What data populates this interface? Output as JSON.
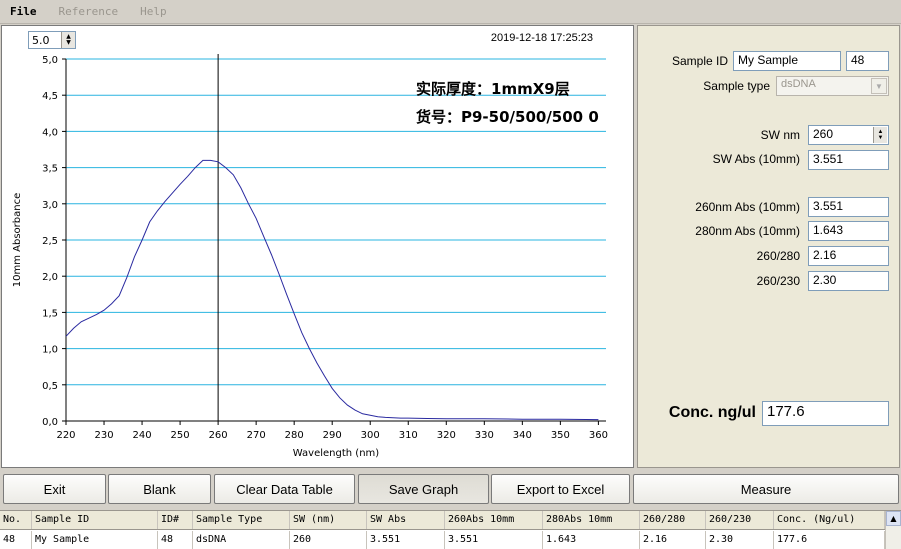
{
  "menu": [
    {
      "label": "File",
      "enabled": true
    },
    {
      "label": "Reference",
      "enabled": false
    },
    {
      "label": "Help",
      "enabled": false
    }
  ],
  "chart": {
    "scale_value": "5.0",
    "timestamp": "2019-12-18 17:25:23",
    "annotation_1": "实际厚度：1mmX9层",
    "annotation_2": "货号：P9-50/500/500 0",
    "line_color": "#2a2aa0",
    "grid_color": "#2ab4e0",
    "cursor_x": 260
  },
  "chart_data": {
    "type": "line",
    "xlabel": "Wavelength (nm)",
    "ylabel": "10mm Absorbance",
    "xlim": [
      220,
      362
    ],
    "ylim": [
      0,
      5
    ],
    "x_ticks": [
      "220",
      "230",
      "240",
      "250",
      "260",
      "270",
      "280",
      "290",
      "300",
      "310",
      "320",
      "330",
      "340",
      "350",
      "360"
    ],
    "y_ticks": [
      "0,0",
      "0,5",
      "1,0",
      "1,5",
      "2,0",
      "2,5",
      "3,0",
      "3,5",
      "4,0",
      "4,5",
      "5,0"
    ],
    "grid": true,
    "x": [
      220,
      222,
      224,
      226,
      228,
      230,
      232,
      234,
      236,
      238,
      240,
      242,
      244,
      246,
      248,
      250,
      252,
      254,
      256,
      258,
      260,
      262,
      264,
      266,
      268,
      270,
      272,
      274,
      276,
      278,
      280,
      282,
      284,
      286,
      288,
      290,
      292,
      294,
      296,
      298,
      300,
      302,
      304,
      306,
      308,
      310,
      315,
      320,
      330,
      340,
      350,
      360
    ],
    "y": [
      1.17,
      1.28,
      1.37,
      1.42,
      1.47,
      1.53,
      1.62,
      1.73,
      1.98,
      2.27,
      2.5,
      2.75,
      2.9,
      3.03,
      3.15,
      3.27,
      3.38,
      3.5,
      3.6,
      3.6,
      3.58,
      3.5,
      3.4,
      3.22,
      3.0,
      2.8,
      2.55,
      2.3,
      2.03,
      1.75,
      1.48,
      1.22,
      1.0,
      0.8,
      0.62,
      0.45,
      0.32,
      0.22,
      0.15,
      0.1,
      0.08,
      0.06,
      0.05,
      0.045,
      0.04,
      0.04,
      0.035,
      0.03,
      0.03,
      0.025,
      0.025,
      0.02
    ]
  },
  "right_panel": {
    "sample_id_label": "Sample ID",
    "sample_id_value": "My Sample",
    "sample_num_value": "48",
    "sample_type_label": "Sample type",
    "sample_type_value": "dsDNA",
    "sw_nm_label": "SW nm",
    "sw_nm_value": "260",
    "sw_abs_label": "SW Abs (10mm)",
    "sw_abs_value": "3.551",
    "abs260_label": "260nm Abs (10mm)",
    "abs260_value": "3.551",
    "abs280_label": "280nm Abs (10mm)",
    "abs280_value": "1.643",
    "r260_280_label": "260/280",
    "r260_280_value": "2.16",
    "r260_230_label": "260/230",
    "r260_230_value": "2.30",
    "conc_label": "Conc. ng/ul",
    "conc_value": "177.6"
  },
  "toolbar": {
    "exit": "Exit",
    "blank": "Blank",
    "clear": "Clear Data Table",
    "save": "Save Graph",
    "export": "Export to Excel",
    "measure": "Measure"
  },
  "table": {
    "headers": [
      "No.",
      "Sample ID",
      "ID#",
      "Sample Type",
      "SW (nm)",
      "SW Abs",
      "260Abs 10mm",
      "280Abs 10mm",
      "260/280",
      "260/230",
      "Conc. (Ng/ul)"
    ],
    "rows": [
      [
        "48",
        "My Sample",
        "48",
        "dsDNA",
        "260",
        "3.551",
        "3.551",
        "1.643",
        "2.16",
        "2.30",
        "177.6"
      ]
    ]
  }
}
